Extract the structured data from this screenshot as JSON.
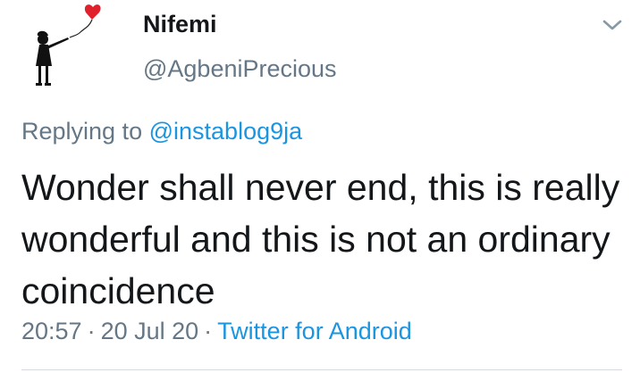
{
  "tweet": {
    "author_name": "Nifemi",
    "author_handle": "@AgbeniPrecious",
    "replying_prefix": "Replying to",
    "replying_to": "@instablog9ja",
    "text": "Wonder shall never end, this is really wonderful and this is not an ordinary coincidence",
    "time": "20:57",
    "date": "20 Jul 20",
    "source": "Twitter for Android",
    "separator": "·"
  },
  "icons": {
    "avatar": "girl-with-balloon-avatar",
    "menu": "chevron-down-icon"
  },
  "colors": {
    "text": "#14171a",
    "secondary": "#657786",
    "link": "#1b95e0",
    "balloon": "#e0202a"
  }
}
